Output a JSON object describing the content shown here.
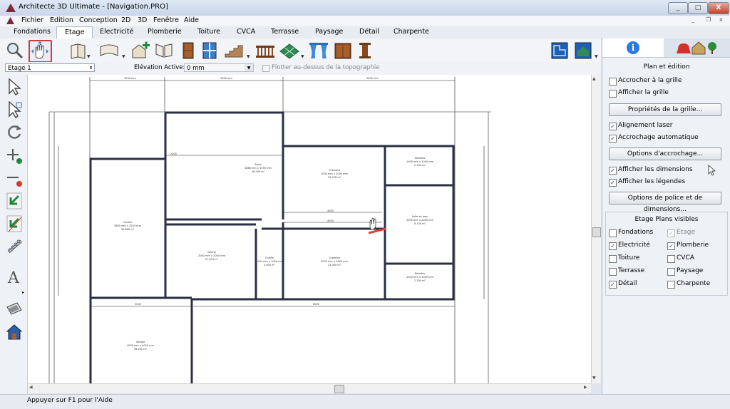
{
  "window": {
    "title": "Architecte 3D Ultimate - [Navigation.PRO]",
    "buttons": {
      "minimize": "_",
      "maximize": "□",
      "close": "X"
    },
    "mdi_buttons": {
      "minimize": "_",
      "restore": "❐",
      "close": "x"
    }
  },
  "menu": [
    "Fichier",
    "Edition",
    "Conception",
    "2D",
    "3D",
    "Fenêtre",
    "Aide"
  ],
  "tabs": [
    "Fondations",
    "Etage",
    "Electricité",
    "Plomberie",
    "Toiture",
    "CVCA",
    "Terrasse",
    "Paysage",
    "Détail",
    "Charpente"
  ],
  "active_tab": "Etage",
  "toolbar": {
    "tools": [
      "zoom-icon",
      "pan-hand-icon",
      "wall-tool-icon",
      "room-tool-icon",
      "add-room-icon",
      "cutout-icon",
      "door-icon",
      "window-icon",
      "stairs-icon",
      "railing-icon",
      "floor-tile-icon",
      "curtain-icon",
      "cabinet-icon",
      "column-icon",
      "plan-view-icon",
      "elevation-view-icon"
    ]
  },
  "levelbar": {
    "level": "Etage 1",
    "elevation_label": "Elévation Active:",
    "elevation_value": "0 mm",
    "float_label": "Flotter au-dessus de la topographie"
  },
  "canvas": {
    "room_labels": [
      {
        "name": "Salon",
        "dims": "1868 mm x 1550 mm",
        "area": "28.950 m²"
      },
      {
        "name": "Chambre",
        "dims": "2000 mm x 2000 mm",
        "area": "23.476 m²"
      },
      {
        "name": "Toilettes",
        "dims": "1000 mm x 1000 mm",
        "area": "2.345 m²"
      },
      {
        "name": "Cuisine",
        "dims": "2800 mm x 3250 mm",
        "area": "26.889 m²"
      },
      {
        "name": "Salle de bain",
        "dims": "1000 mm x 2000 mm",
        "area": "9.100 m²"
      },
      {
        "name": "Dining",
        "dims": "2000 mm x 2000 mm",
        "area": "27.879 m²"
      },
      {
        "name": "Entrée",
        "dims": "1000 mm x 1000 mm",
        "area": "4.600 m²"
      },
      {
        "name": "Chambre",
        "dims": "2000 mm x 2000 mm",
        "area": "23.000 m²"
      },
      {
        "name": "Toilettes",
        "dims": "1000 mm x 1000 mm",
        "area": "2.300 m²"
      },
      {
        "name": "Garage",
        "dims": "4000 mm x 4000 mm",
        "area": "36.000 m²"
      }
    ]
  },
  "status": "Appuyer sur F1 pour l'Aide",
  "right_panel": {
    "tab_icons": [
      "info-icon",
      "furniture-icon"
    ],
    "title": "Plan et édition",
    "checks1": [
      {
        "label": "Accrocher à la grille",
        "checked": false
      },
      {
        "label": "Afficher la grille",
        "checked": false
      }
    ],
    "grid_button": "Propriétés de la grille...",
    "checks2": [
      {
        "label": "Alignement laser",
        "checked": true
      },
      {
        "label": "Accrochage automatique",
        "checked": true
      }
    ],
    "snap_button": "Options d'accrochage...",
    "checks3": [
      {
        "label": "Afficher les dimensions",
        "checked": true
      },
      {
        "label": "Afficher les légendes",
        "checked": true
      }
    ],
    "font_button": "Options de police et de dimensions...",
    "plans_title": "Etage Plans visibles",
    "plans": [
      {
        "label": "Fondations",
        "checked": false,
        "enabled": true
      },
      {
        "label": "Etage",
        "checked": true,
        "enabled": false
      },
      {
        "label": "Electricité",
        "checked": true,
        "enabled": true
      },
      {
        "label": "Plomberie",
        "checked": true,
        "enabled": true
      },
      {
        "label": "Toiture",
        "checked": false,
        "enabled": true
      },
      {
        "label": "CVCA",
        "checked": false,
        "enabled": true
      },
      {
        "label": "Terrasse",
        "checked": false,
        "enabled": true
      },
      {
        "label": "Paysage",
        "checked": false,
        "enabled": true
      },
      {
        "label": "Détail",
        "checked": true,
        "enabled": true
      },
      {
        "label": "Charpente",
        "checked": false,
        "enabled": true
      }
    ]
  },
  "colors": {
    "accent": "#3a6fd0",
    "highlight": "#e04040",
    "wall": "#2a2f44"
  }
}
